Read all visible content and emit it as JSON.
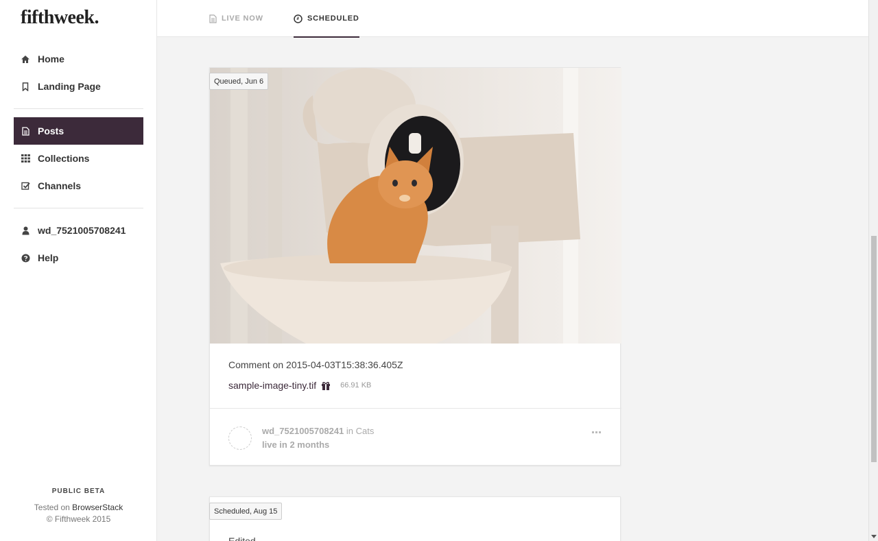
{
  "brand": {
    "logo": "fifthweek."
  },
  "nav": {
    "primary": [
      {
        "label": "Home",
        "icon": "home-icon"
      },
      {
        "label": "Landing Page",
        "icon": "bookmark-icon"
      }
    ],
    "secondary": [
      {
        "label": "Posts",
        "icon": "document-icon",
        "active": true
      },
      {
        "label": "Collections",
        "icon": "grid-icon"
      },
      {
        "label": "Channels",
        "icon": "checkbox-icon"
      }
    ],
    "account": [
      {
        "label": "wd_7521005708241",
        "icon": "user-icon"
      },
      {
        "label": "Help",
        "icon": "question-circle-icon"
      }
    ]
  },
  "footer": {
    "beta": "PUBLIC BETA",
    "tested_prefix": "Tested on ",
    "tested_link": "BrowserStack",
    "copyright": "© Fifthweek 2015"
  },
  "tabs": [
    {
      "label": "LIVE NOW",
      "icon": "document-icon",
      "active": false
    },
    {
      "label": "SCHEDULED",
      "icon": "clock-icon",
      "active": true
    }
  ],
  "posts": [
    {
      "badge": "Queued, Jun 6",
      "image_alt": "kitten photo",
      "comment": "Comment on 2015-04-03T15:38:36.405Z",
      "file_name": "sample-image-tiny.tif",
      "file_size": "66.91 KB",
      "author": "wd_7521005708241",
      "in_word": " in ",
      "channel": "Cats",
      "live": "live in 2 months"
    },
    {
      "badge": "Scheduled, Aug 15",
      "text": "Edited"
    }
  ],
  "colors": {
    "accent": "#3c2a3a",
    "background": "#f3f3f3"
  }
}
